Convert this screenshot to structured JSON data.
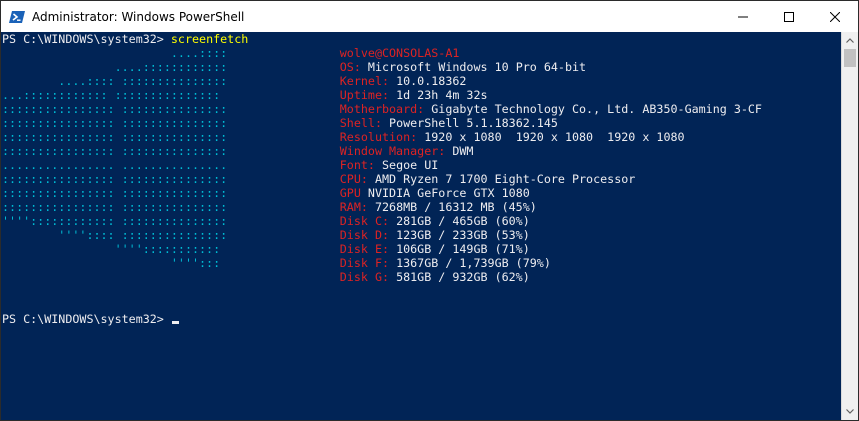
{
  "window": {
    "title": "Administrator: Windows PowerShell",
    "icon": "powershell-icon"
  },
  "colors": {
    "background": "#012456",
    "text": "#eeedf0",
    "command": "#ffff00",
    "logo": "#00bcd4",
    "key": "#dd2323"
  },
  "console": {
    "prompt": "PS C:\\WINDOWS\\system32> ",
    "command": "screenfetch",
    "user_host": "wolve@CONSOLAS-A1",
    "lines": [
      {
        "logo": "                        ....::::                ",
        "key": "",
        "value": ""
      },
      {
        "logo": "                ....::::::::::::                ",
        "key": "OS: ",
        "value": "Microsoft Windows 10 Pro 64-bit"
      },
      {
        "logo": "        ....:::: :::::::::::::::                ",
        "key": "Kernel: ",
        "value": "10.0.18362"
      },
      {
        "logo": "...:::::::::::: :::::::::::::::                 ",
        "key": "Uptime: ",
        "value": "1d 23h 4m 32s"
      },
      {
        "logo": ":::::::::::::::: :::::::::::::::                ",
        "key": "Motherboard: ",
        "value": "Gigabyte Technology Co., Ltd. AB350-Gaming 3-CF"
      },
      {
        "logo": ":::::::::::::::: :::::::::::::::                ",
        "key": "Shell: ",
        "value": "PowerShell 5.1.18362.145"
      },
      {
        "logo": ":::::::::::::::: :::::::::::::::                ",
        "key": "Resolution: ",
        "value": "1920 x 1080  1920 x 1080  1920 x 1080"
      },
      {
        "logo": ":::::::::::::::: :::::::::::::::                ",
        "key": "Window Manager: ",
        "value": "DWM"
      },
      {
        "logo": "................ ...............                ",
        "key": "Font: ",
        "value": "Segoe UI"
      },
      {
        "logo": ":::::::::::::::: :::::::::::::::                ",
        "key": "CPU: ",
        "value": "AMD Ryzen 7 1700 Eight-Core Processor"
      },
      {
        "logo": ":::::::::::::::: :::::::::::::::                ",
        "key": "GPU ",
        "value": "NVIDIA GeForce GTX 1080"
      },
      {
        "logo": ":::::::::::::::: :::::::::::::::                ",
        "key": "RAM: ",
        "value": "7268MB / 16312 MB (45%)"
      },
      {
        "logo": "'''':::::::::::: :::::::::::::::                ",
        "key": "Disk C: ",
        "value": "281GB / 465GB (60%)"
      },
      {
        "logo": "        '''':::: :::::::::::::::                ",
        "key": "Disk D: ",
        "value": "123GB / 233GB (53%)"
      },
      {
        "logo": "                '''':::::::::::                 ",
        "key": "Disk E: ",
        "value": "106GB / 149GB (71%)"
      },
      {
        "logo": "                        '''':::                 ",
        "key": "Disk F: ",
        "value": "1367GB / 1,739GB (79%)"
      },
      {
        "logo": "                                                ",
        "key": "Disk G: ",
        "value": "581GB / 932GB (62%)"
      }
    ]
  }
}
